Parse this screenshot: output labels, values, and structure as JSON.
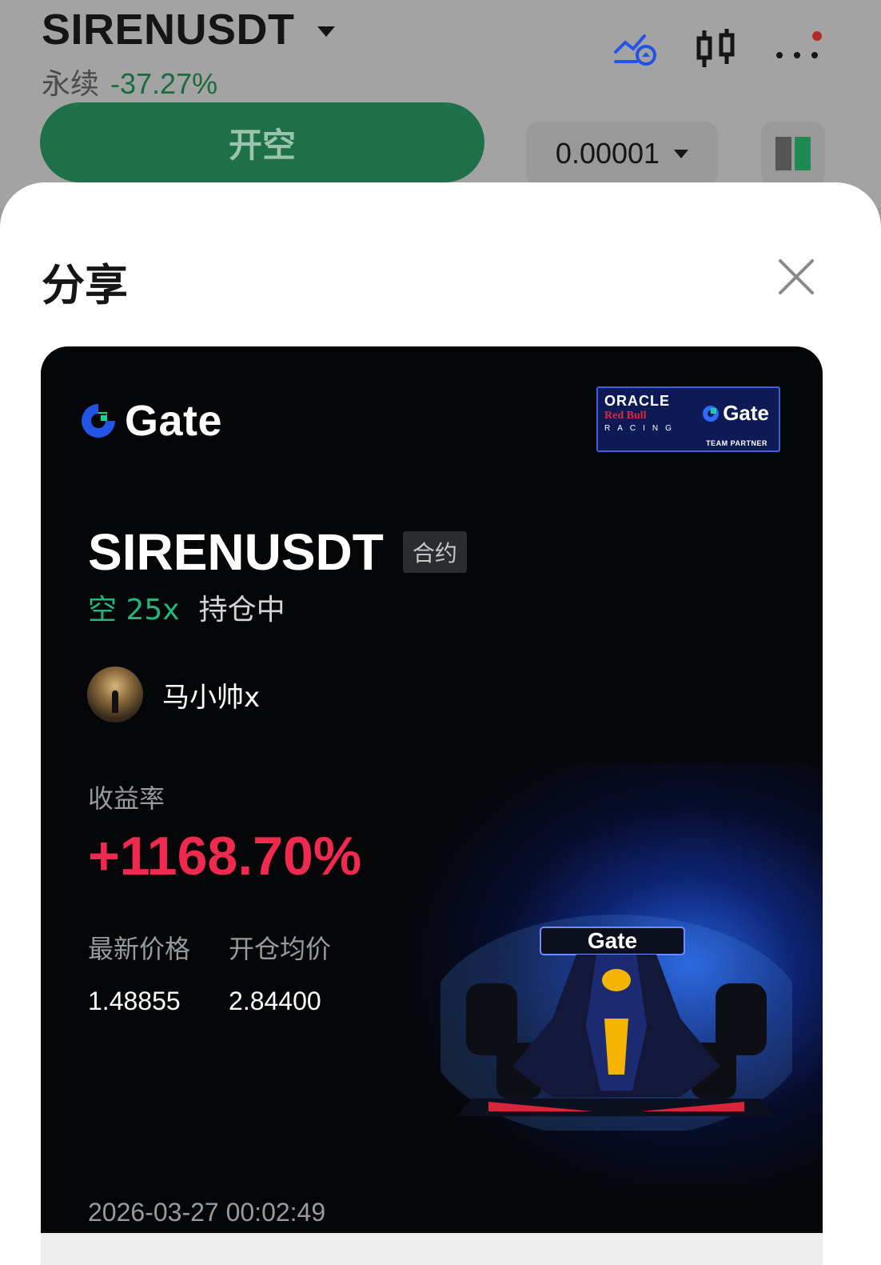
{
  "header": {
    "pair": "SIRENUSDT",
    "market_type": "永续",
    "change": "-37.27%",
    "icons": [
      "price-alert-icon",
      "candlestick-icon",
      "more-icon"
    ]
  },
  "trade": {
    "open_short_label": "开空",
    "tick_size": "0.00001"
  },
  "share_sheet": {
    "title": "分享",
    "card": {
      "brand": "Gate",
      "partner": {
        "line1": "ORACLE",
        "line2": "Red Bull",
        "line3": "RACING",
        "brand": "Gate",
        "tag": "TEAM PARTNER"
      },
      "symbol": "SIRENUSDT",
      "contract_badge": "合约",
      "side": "空 25x",
      "status": "持仓中",
      "username": "马小帅x",
      "roi_label": "收益率",
      "roi_value": "+1168.70%",
      "latest_price_label": "最新价格",
      "latest_price": "1.48855",
      "entry_price_label": "开仓均价",
      "entry_price": "2.84400",
      "timestamp": "2026-03-27 00:02:49",
      "car_wing_text": "Gate"
    }
  },
  "colors": {
    "accent_green": "#22b67c",
    "button_green": "#1e7049",
    "roi_red": "#f0294f",
    "gate_blue": "#2354e6"
  }
}
